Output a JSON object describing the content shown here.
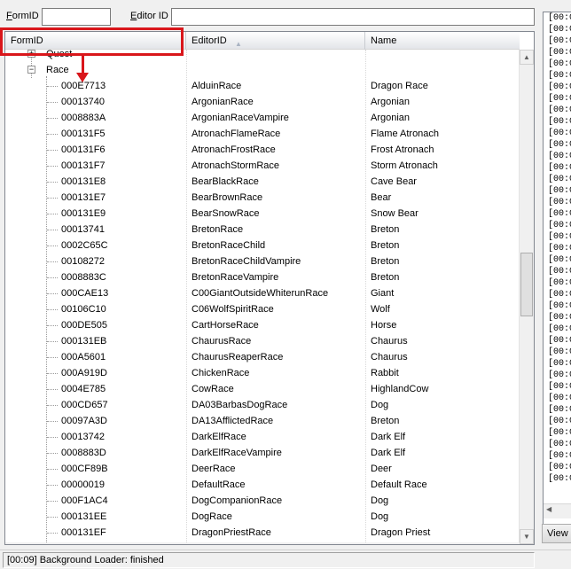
{
  "filter": {
    "formid_label": "FormID",
    "formid_underline": "F",
    "formid_rest": "ormID",
    "editorid_label": "Editor ID",
    "editorid_underline": "E",
    "editorid_rest": "ditor ID",
    "formid_value": "",
    "editorid_value": ""
  },
  "columns": {
    "formid": "FormID",
    "editorid": "EditorID",
    "name": "Name",
    "sort_icon": "sort-ascending-icon"
  },
  "tree": {
    "quest_label": "Quest",
    "race_label": "Race",
    "expand_glyph": "+",
    "collapse_glyph": "−"
  },
  "rows": [
    {
      "formid": "000E7713",
      "editorid": "AlduinRace",
      "name": "Dragon Race"
    },
    {
      "formid": "00013740",
      "editorid": "ArgonianRace",
      "name": "Argonian"
    },
    {
      "formid": "0008883A",
      "editorid": "ArgonianRaceVampire",
      "name": "Argonian"
    },
    {
      "formid": "000131F5",
      "editorid": "AtronachFlameRace",
      "name": "Flame Atronach"
    },
    {
      "formid": "000131F6",
      "editorid": "AtronachFrostRace",
      "name": "Frost Atronach"
    },
    {
      "formid": "000131F7",
      "editorid": "AtronachStormRace",
      "name": "Storm Atronach"
    },
    {
      "formid": "000131E8",
      "editorid": "BearBlackRace",
      "name": "Cave Bear"
    },
    {
      "formid": "000131E7",
      "editorid": "BearBrownRace",
      "name": "Bear"
    },
    {
      "formid": "000131E9",
      "editorid": "BearSnowRace",
      "name": "Snow Bear"
    },
    {
      "formid": "00013741",
      "editorid": "BretonRace",
      "name": "Breton"
    },
    {
      "formid": "0002C65C",
      "editorid": "BretonRaceChild",
      "name": "Breton"
    },
    {
      "formid": "00108272",
      "editorid": "BretonRaceChildVampire",
      "name": "Breton"
    },
    {
      "formid": "0008883C",
      "editorid": "BretonRaceVampire",
      "name": "Breton"
    },
    {
      "formid": "000CAE13",
      "editorid": "C00GiantOutsideWhiterunRace",
      "name": "Giant"
    },
    {
      "formid": "00106C10",
      "editorid": "C06WolfSpiritRace",
      "name": "Wolf"
    },
    {
      "formid": "000DE505",
      "editorid": "CartHorseRace",
      "name": "Horse"
    },
    {
      "formid": "000131EB",
      "editorid": "ChaurusRace",
      "name": "Chaurus"
    },
    {
      "formid": "000A5601",
      "editorid": "ChaurusReaperRace",
      "name": "Chaurus"
    },
    {
      "formid": "000A919D",
      "editorid": "ChickenRace",
      "name": "Rabbit"
    },
    {
      "formid": "0004E785",
      "editorid": "CowRace",
      "name": "HighlandCow"
    },
    {
      "formid": "000CD657",
      "editorid": "DA03BarbasDogRace",
      "name": "Dog"
    },
    {
      "formid": "00097A3D",
      "editorid": "DA13AfflictedRace",
      "name": "Breton"
    },
    {
      "formid": "00013742",
      "editorid": "DarkElfRace",
      "name": "Dark Elf"
    },
    {
      "formid": "0008883D",
      "editorid": "DarkElfRaceVampire",
      "name": "Dark Elf"
    },
    {
      "formid": "000CF89B",
      "editorid": "DeerRace",
      "name": "Deer"
    },
    {
      "formid": "00000019",
      "editorid": "DefaultRace",
      "name": "Default Race"
    },
    {
      "formid": "000F1AC4",
      "editorid": "DogCompanionRace",
      "name": "Dog"
    },
    {
      "formid": "000131EE",
      "editorid": "DogRace",
      "name": "Dog"
    },
    {
      "formid": "000131EF",
      "editorid": "DragonPriestRace",
      "name": "Dragon Priest"
    }
  ],
  "log": {
    "lines": [
      "[00:0",
      "[00:0",
      "[00:0",
      "[00:0",
      "[00:0",
      "[00:0",
      "[00:0",
      "[00:0",
      "[00:0",
      "[00:0",
      "[00:0",
      "[00:0",
      "[00:0",
      "[00:0",
      "[00:0",
      "[00:0",
      "[00:0",
      "[00:0",
      "[00:0",
      "[00:0",
      "[00:0",
      "[00:0",
      "[00:0",
      "[00:0",
      "[00:0",
      "[00:0",
      "[00:0",
      "[00:0",
      "[00:0",
      "[00:0",
      "[00:0",
      "[00:0",
      "[00:0",
      "[00:0",
      "[00:0",
      "[00:0",
      "[00:0",
      "[00:0",
      "[00:0",
      "[00:0",
      "[00:0"
    ],
    "view_button": "View"
  },
  "status": {
    "text": "[00:09] Background Loader: finished"
  },
  "annotation": {
    "highlight_color": "#d9161b"
  },
  "scrollbar": {
    "up_glyph": "▲",
    "down_glyph": "▼",
    "left_glyph": "◀",
    "position_fraction": 0.47
  }
}
